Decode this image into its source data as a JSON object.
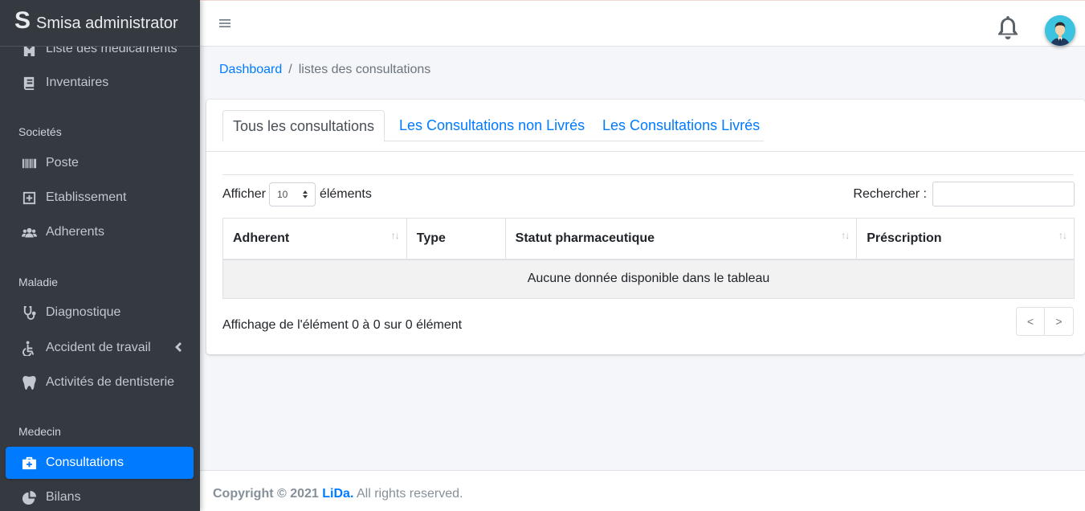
{
  "brand": {
    "logo": "S",
    "name": "Smisa administrator"
  },
  "sidebar": {
    "items": [
      {
        "label": "Liste des médicaments",
        "icon": "hospital-icon"
      },
      {
        "label": "Inventaires",
        "icon": "book-icon"
      },
      {
        "label": "Poste",
        "icon": "barcode-icon"
      },
      {
        "label": "Etablissement",
        "icon": "plus-square-icon"
      },
      {
        "label": "Adherents",
        "icon": "users-icon"
      },
      {
        "label": "Diagnostique",
        "icon": "stethoscope-icon"
      },
      {
        "label": "Accident de travail",
        "icon": "wheelchair-icon"
      },
      {
        "label": "Activités de dentisterie",
        "icon": "tooth-icon"
      },
      {
        "label": "Consultations",
        "icon": "medkit-icon"
      },
      {
        "label": "Bilans",
        "icon": "pie-chart-icon"
      }
    ],
    "headers": [
      "Societés",
      "Maladie",
      "Medecin"
    ]
  },
  "breadcrumb": {
    "home": "Dashboard",
    "separator": "/",
    "current": "listes des consultations"
  },
  "tabs": [
    {
      "label": "Tous les consultations",
      "active": true
    },
    {
      "label": "Les Consultations non Livrés",
      "active": false
    },
    {
      "label": "Les Consultations Livrés",
      "active": false
    }
  ],
  "table_controls": {
    "show_label": "Afficher",
    "page_length": "10",
    "items_label": "éléments",
    "search_label": "Rechercher :",
    "search_value": ""
  },
  "table": {
    "columns": [
      "Adherent",
      "Type",
      "Statut pharmaceutique",
      "Préscription"
    ],
    "empty_message": "Aucune donnée disponible dans le tableau"
  },
  "info": "Affichage de l'élément 0 à 0 sur 0 élément",
  "pagination": {
    "prev": "<",
    "next": ">"
  },
  "footer": {
    "prefix": "Copyright © 2021",
    "brand": "LiDa.",
    "suffix": "All rights reserved."
  },
  "colors": {
    "sidebar_bg": "#343a40",
    "accent": "#007bff",
    "page_bg": "#f4f6f9"
  }
}
